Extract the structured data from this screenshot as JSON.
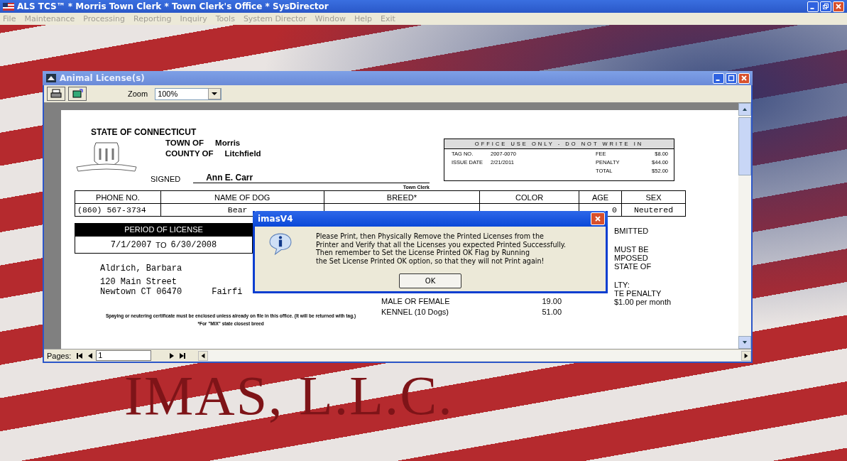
{
  "app_window": {
    "title": "ALS TCS™ * Morris Town Clerk * Town Clerk's Office * SysDirector"
  },
  "menu": [
    "File",
    "Maintenance",
    "Processing",
    "Reporting",
    "Inquiry",
    "Tools",
    "System Director",
    "Window",
    "Help",
    "Exit"
  ],
  "desktop": {
    "banner": "IMAS, L.L.C."
  },
  "child_window": {
    "title": "Animal License(s)",
    "zoom_label": "Zoom",
    "zoom_value": "100%"
  },
  "license": {
    "state": "STATE OF CONNECTICUT",
    "town_label": "TOWN OF",
    "town": "Morris",
    "county_label": "COUNTY OF",
    "county": "Litchfield",
    "signed_label": "SIGNED",
    "signed": "Ann E. Carr",
    "signer_title": "Town Clerk",
    "office_box": {
      "heading": "OFFICE USE ONLY - DO NOT WRITE IN",
      "left": [
        {
          "label": "TAG NO.",
          "value": "2007-0070"
        },
        {
          "label": "ISSUE DATE",
          "value": "2/21/2011"
        }
      ],
      "right": [
        {
          "label": "FEE",
          "value": "$8.00"
        },
        {
          "label": "PENALTY",
          "value": "$44.00"
        },
        {
          "label": "TOTAL",
          "value": "$52.00"
        }
      ]
    },
    "table": {
      "columns": [
        "PHONE NO.",
        "NAME OF DOG",
        "BREED*",
        "COLOR",
        "AGE",
        "SEX"
      ],
      "row": {
        "phone": "(860) 567-3734",
        "name": "Bear",
        "age": "0",
        "sex": "Neutered"
      }
    },
    "period": {
      "heading": "PERIOD OF LICENSE",
      "from": "7/1/2007",
      "to_word": "TO",
      "to": "6/30/2008"
    },
    "owner": {
      "name": "Aldrich, Barbara",
      "street": "120  Main Street",
      "city": "Newtown CT 06470",
      "county": "Fairfi"
    },
    "fees": [
      {
        "label": "MALE OR FEMALE",
        "amount": "19.00"
      },
      {
        "label": "KENNEL (10 Dogs)",
        "amount": "51.00"
      }
    ],
    "notice_fragments": [
      {
        "lines": [
          "BMITTED"
        ]
      },
      {
        "lines": [
          "MUST BE",
          "MPOSED",
          "STATE OF"
        ]
      },
      {
        "lines": [
          "LTY:",
          "TE PENALTY",
          "$1.00 per month"
        ]
      }
    ],
    "footnotes": [
      "Spaying or neutering certificate must be enclosed unless already on file in this office. (It will be returned with tag.)",
      "*For \"MIX\" state closest breed"
    ]
  },
  "pager": {
    "label": "Pages:",
    "page": "1"
  },
  "dialog": {
    "title": "imasV4",
    "lines": [
      "Please Print, then Physically Remove the Printed Licenses from the",
      "Printer and Verify that all the Licenses you expected Printed Successfully.",
      "Then remember to Set the License Printed OK Flag by Running",
      "the Set License Printed OK option, so that they will not Print again!"
    ],
    "button": "OK"
  }
}
